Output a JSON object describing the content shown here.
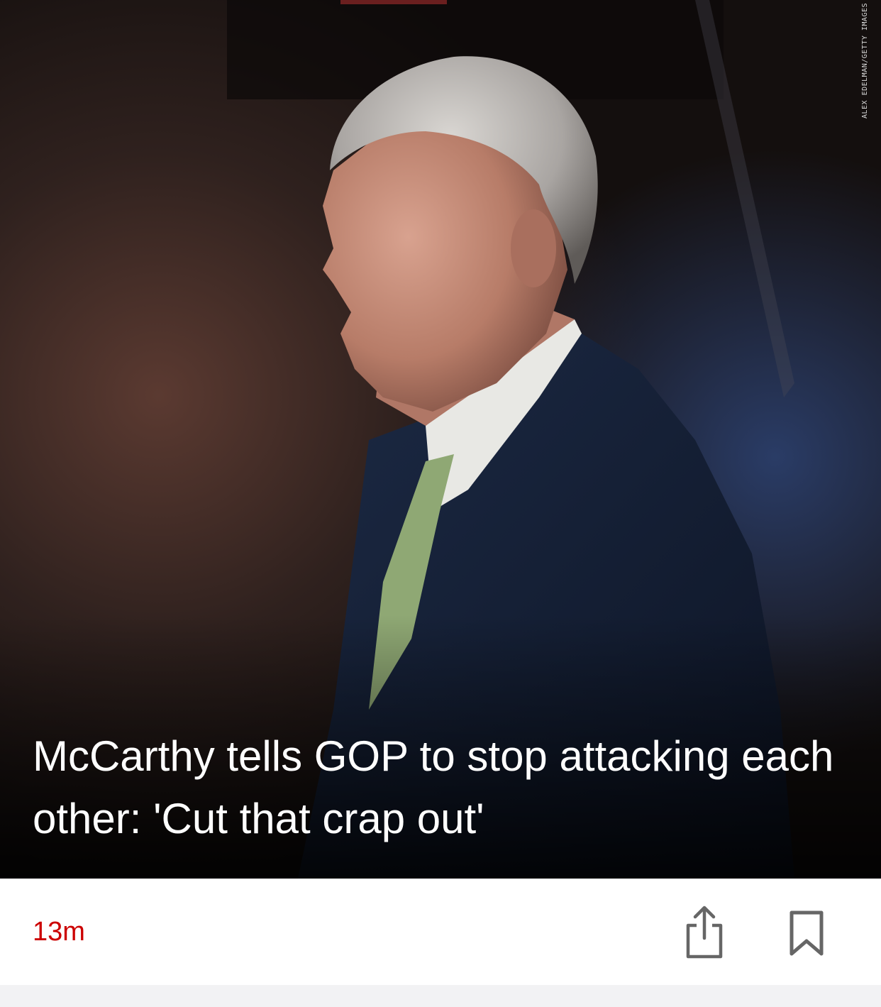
{
  "article": {
    "headline": "McCarthy tells GOP to stop attacking each other: 'Cut that crap out'",
    "photo_credit": "ALEX EDELMAN/GETTY IMAGES",
    "timestamp": "13m"
  },
  "actions": {
    "share_icon": "share-icon",
    "bookmark_icon": "bookmark-icon"
  },
  "colors": {
    "timestamp": "#cc0000",
    "icon": "#666666",
    "headline": "#ffffff"
  }
}
